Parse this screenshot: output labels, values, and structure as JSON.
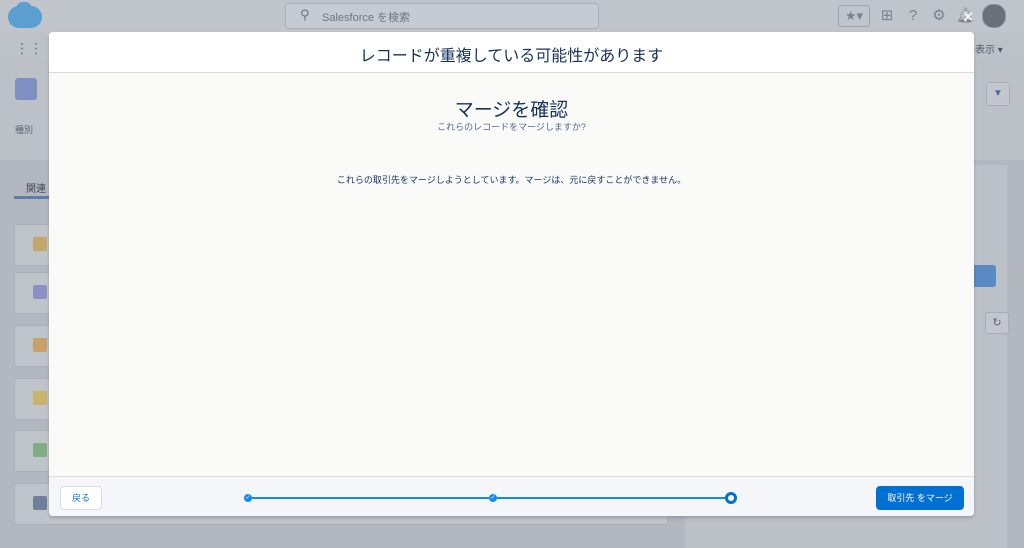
{
  "background": {
    "search_placeholder": "Salesforce を検索",
    "nav_right_label": "表示",
    "field_label": "種別",
    "tab_label": "関連"
  },
  "modal": {
    "title": "レコードが重複している可能性があります",
    "body_title": "マージを確認",
    "body_subtitle": "これらのレコードをマージしますか?",
    "message": "これらの取引先をマージしようとしています。マージは、元に戻すことができません。",
    "back_button": "戻る",
    "merge_button": "取引先 をマージ",
    "close_glyph": "✕",
    "progress": {
      "total_steps": 3,
      "current_step": 3
    }
  },
  "colors": {
    "brand": "#0070d2",
    "progress": "#1589ee",
    "text": "#16325c"
  },
  "icons": {
    "close": "close-icon",
    "search": "search-icon",
    "check": "check-icon"
  }
}
